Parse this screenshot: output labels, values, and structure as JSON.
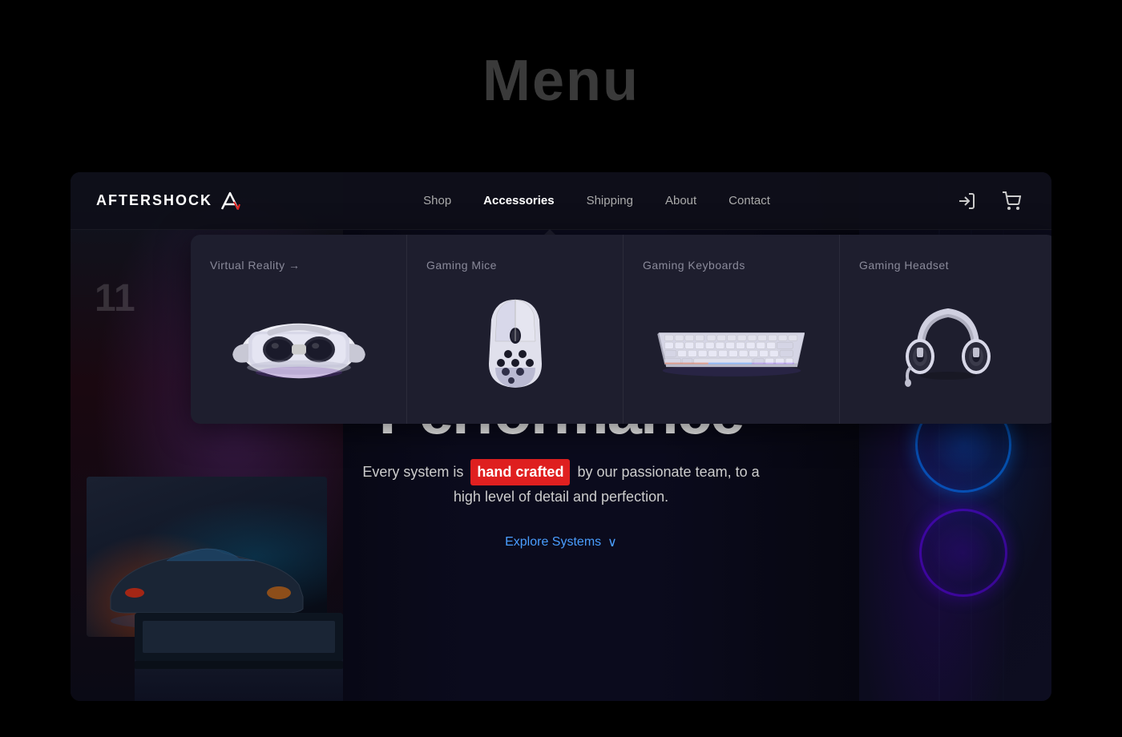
{
  "page": {
    "bg_title": "Menu"
  },
  "navbar": {
    "brand": "AFTERSHOCK",
    "links": [
      {
        "id": "shop",
        "label": "Shop",
        "active": false
      },
      {
        "id": "accessories",
        "label": "Accessories",
        "active": true
      },
      {
        "id": "shipping",
        "label": "Shipping",
        "active": false
      },
      {
        "id": "about",
        "label": "About",
        "active": false
      },
      {
        "id": "contact",
        "label": "Contact",
        "active": false
      }
    ]
  },
  "dropdown": {
    "cols": [
      {
        "id": "vr",
        "title": "Virtual Reality →"
      },
      {
        "id": "mice",
        "title": "Gaming Mice"
      },
      {
        "id": "keyboards",
        "title": "Gaming Keyboards"
      },
      {
        "id": "headset",
        "title": "Gaming Headset"
      }
    ]
  },
  "hero": {
    "title": "Performance",
    "subtitle_before": "Every system is",
    "highlight": "hand crafted",
    "subtitle_after": "by our passionate team, to a high level of detail and perfection.",
    "cta": "Explore Systems",
    "cta_chevron": "∨",
    "number": "11"
  }
}
